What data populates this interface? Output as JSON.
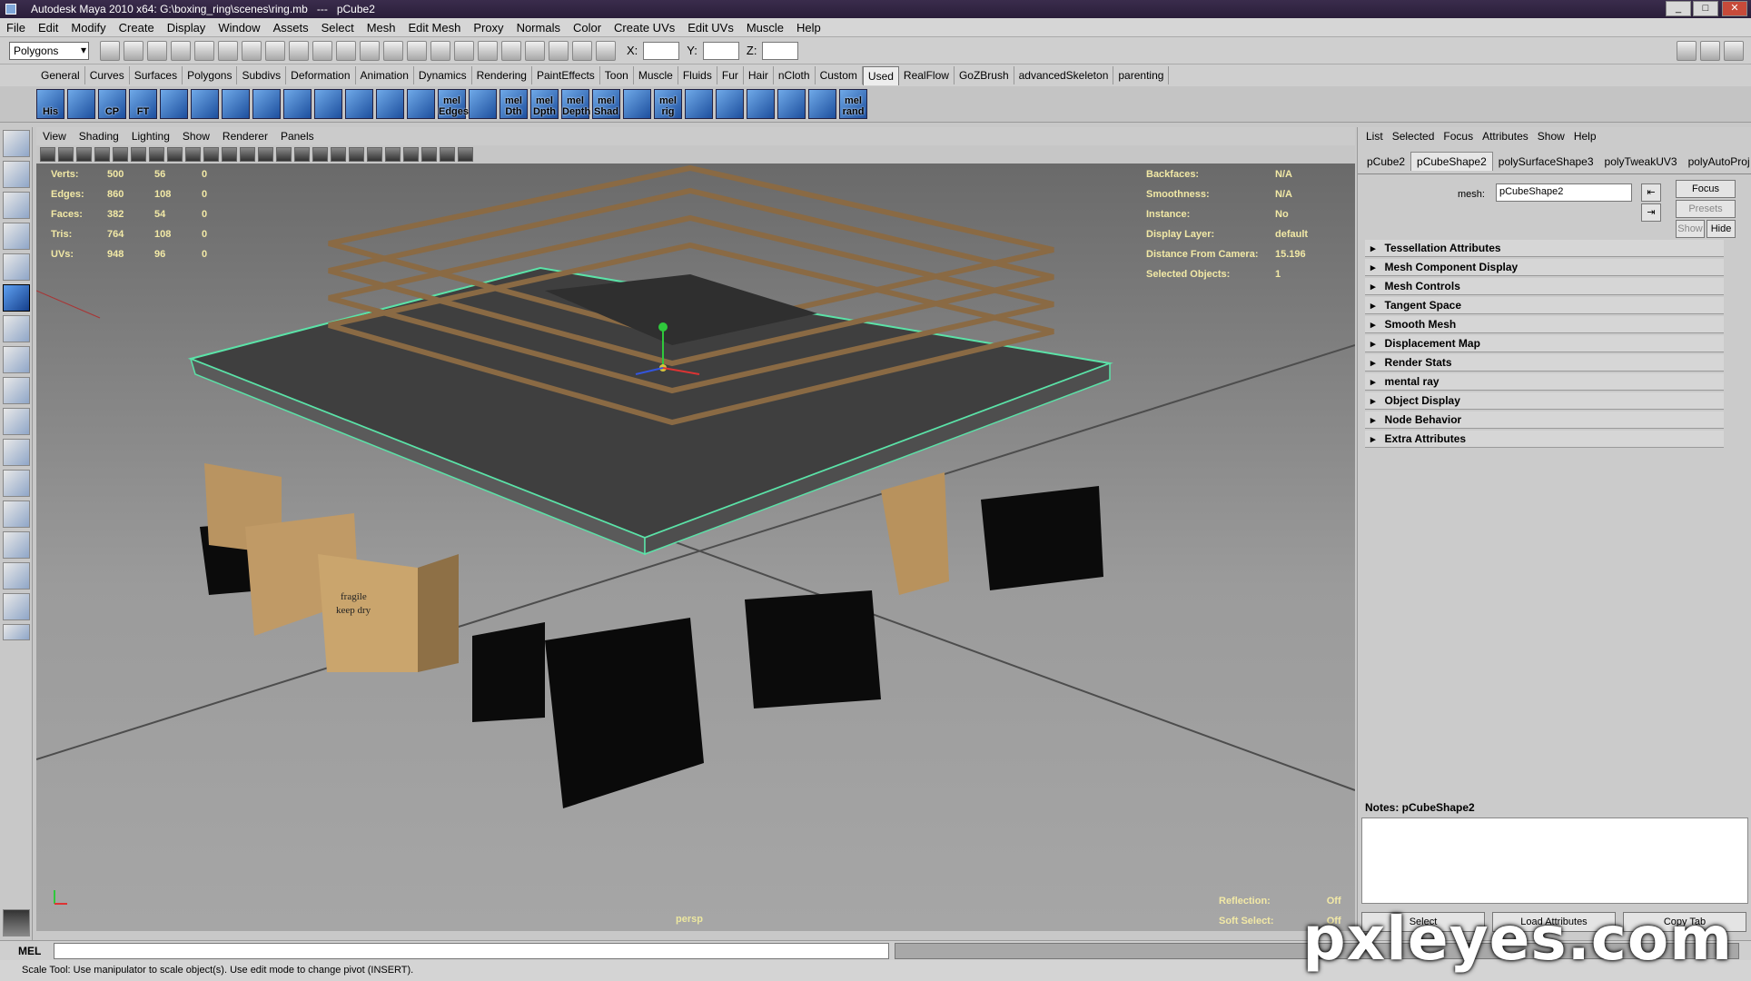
{
  "window": {
    "title": "Autodesk Maya 2010 x64: G:\\boxing_ring\\scenes\\ring.mb   ---   pCube2",
    "min": "_",
    "max": "□",
    "close": "✕"
  },
  "menu": [
    "File",
    "Edit",
    "Modify",
    "Create",
    "Display",
    "Window",
    "Assets",
    "Select",
    "Mesh",
    "Edit Mesh",
    "Proxy",
    "Normals",
    "Color",
    "Create UVs",
    "Edit UVs",
    "Muscle",
    "Help"
  ],
  "status_line": {
    "mode": "Polygons",
    "x_label": "X:",
    "y_label": "Y:",
    "z_label": "Z:"
  },
  "shelf_tabs": [
    "General",
    "Curves",
    "Surfaces",
    "Polygons",
    "Subdivs",
    "Deformation",
    "Animation",
    "Dynamics",
    "Rendering",
    "PaintEffects",
    "Toon",
    "Muscle",
    "Fluids",
    "Fur",
    "Hair",
    "nCloth",
    "Custom",
    "Used",
    "RealFlow",
    "GoZBrush",
    "advancedSkeleton",
    "parenting"
  ],
  "active_shelf_tab": "Used",
  "shelf_buttons": [
    "His",
    "",
    "CP",
    "FT",
    "",
    "",
    "",
    "",
    "",
    "",
    "",
    "",
    "",
    "mel Edges",
    "",
    "mel Dth",
    "mel Dpth",
    "mel Depth",
    "mel Shad",
    "",
    "mel rig",
    "",
    "",
    "",
    "",
    "",
    "mel rand"
  ],
  "viewport": {
    "menu": [
      "View",
      "Shading",
      "Lighting",
      "Show",
      "Renderer",
      "Panels"
    ],
    "camera": "persp",
    "hud_left": [
      {
        "label": "Verts:",
        "a": "500",
        "b": "56",
        "c": "0"
      },
      {
        "label": "Edges:",
        "a": "860",
        "b": "108",
        "c": "0"
      },
      {
        "label": "Faces:",
        "a": "382",
        "b": "54",
        "c": "0"
      },
      {
        "label": "Tris:",
        "a": "764",
        "b": "108",
        "c": "0"
      },
      {
        "label": "UVs:",
        "a": "948",
        "b": "96",
        "c": "0"
      }
    ],
    "hud_right": [
      {
        "label": "Backfaces:",
        "value": "N/A"
      },
      {
        "label": "Smoothness:",
        "value": "N/A"
      },
      {
        "label": "Instance:",
        "value": "No"
      },
      {
        "label": "Display Layer:",
        "value": "default"
      },
      {
        "label": "Distance From Camera:",
        "value": "15.196"
      },
      {
        "label": "Selected Objects:",
        "value": "1"
      }
    ],
    "hud_bottom": [
      {
        "label": "Reflection:",
        "value": "Off"
      },
      {
        "label": "Soft Select:",
        "value": "Off"
      }
    ],
    "box_label_1": "fragile",
    "box_label_2": "keep dry",
    "colors": {
      "mat": "#4a4a4a",
      "selection": "#5be3a8",
      "rope": "#8a6a44",
      "box": "#c9a36a"
    }
  },
  "attribute_editor": {
    "menu": [
      "List",
      "Selected",
      "Focus",
      "Attributes",
      "Show",
      "Help"
    ],
    "tabs": [
      "pCube2",
      "pCubeShape2",
      "polySurfaceShape3",
      "polyTweakUV3",
      "polyAutoProj"
    ],
    "active_tab": "pCubeShape2",
    "mesh_label": "mesh:",
    "mesh_value": "pCubeShape2",
    "focus": "Focus",
    "presets": "Presets",
    "show": "Show",
    "hide": "Hide",
    "sections": [
      "Tessellation Attributes",
      "Mesh Component Display",
      "Mesh Controls",
      "Tangent Space",
      "Smooth Mesh",
      "Displacement Map",
      "Render Stats",
      "mental ray",
      "Object Display",
      "Node Behavior",
      "Extra Attributes"
    ],
    "notes_label": "Notes:  pCubeShape2",
    "bottom_buttons": [
      "Select",
      "Load Attributes",
      "Copy Tab"
    ]
  },
  "command_line": {
    "label": "MEL"
  },
  "help_line": "Scale Tool: Use manipulator to scale object(s). Use edit mode to change pivot (INSERT).",
  "watermark": "pxleyes.com"
}
